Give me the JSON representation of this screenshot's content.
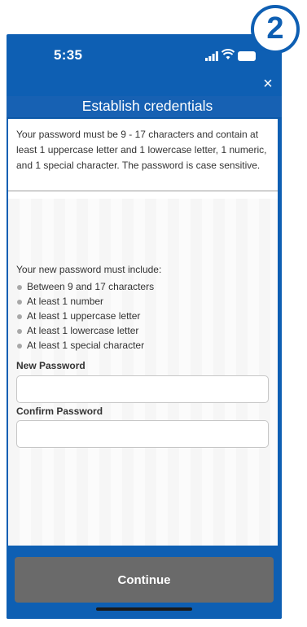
{
  "status_bar": {
    "time": "5:35"
  },
  "step_badge": "2",
  "header": {
    "close_label": "×",
    "title": "Establish credentials"
  },
  "info_text": "Your password must be 9 - 17 characters and contain at least 1 uppercase letter and 1 lowercase letter, 1 numeric, and 1 special character. The password is case sensitive.",
  "requirements": {
    "intro": "Your new password must include:",
    "items": [
      "Between 9 and 17 characters",
      "At least 1 number",
      "At least 1 uppercase letter",
      "At least 1 lowercase letter",
      "At least 1 special character"
    ]
  },
  "form": {
    "new_password_label": "New Password",
    "new_password_value": "",
    "confirm_password_label": "Confirm Password",
    "confirm_password_value": ""
  },
  "footer": {
    "continue_label": "Continue"
  },
  "colors": {
    "brand_blue": "#0e5fb3",
    "button_gray": "#6a6a6a"
  }
}
